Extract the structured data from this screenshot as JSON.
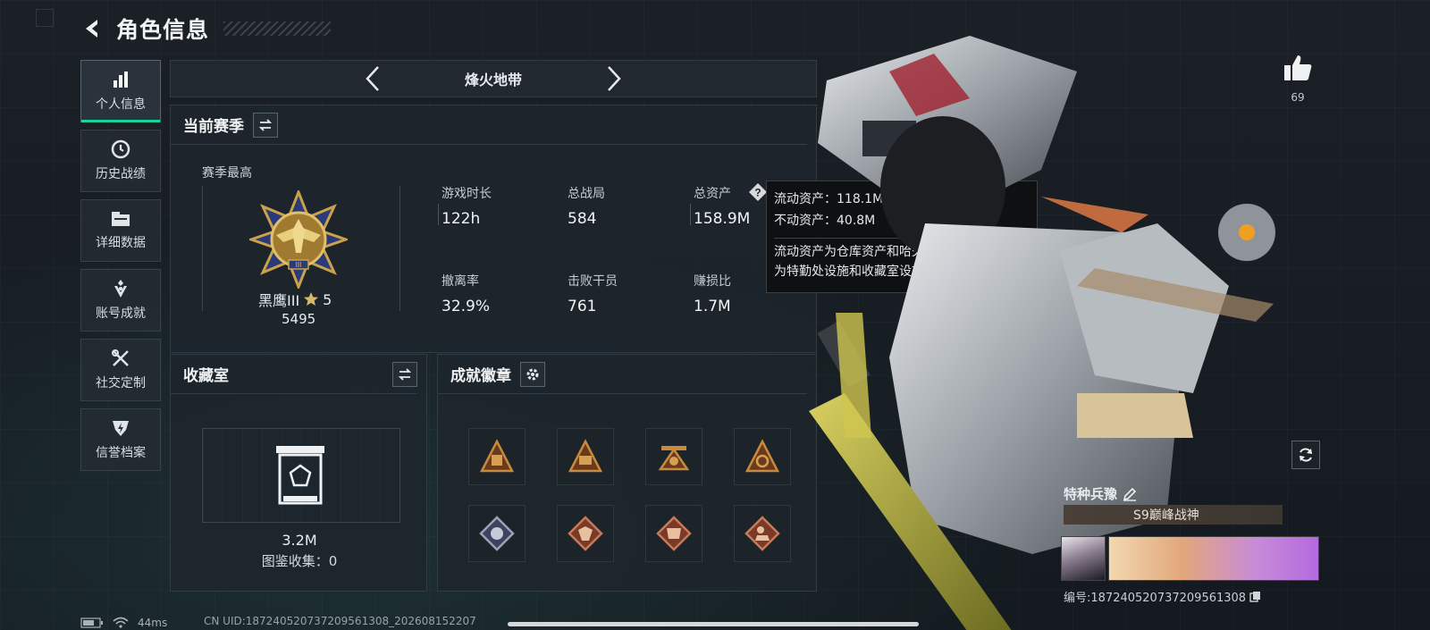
{
  "header": {
    "title": "角色信息"
  },
  "sidebar": {
    "items": [
      {
        "label": "个人信息",
        "icon": "bar-chart-icon",
        "active": true
      },
      {
        "label": "历史战绩",
        "icon": "clock-icon"
      },
      {
        "label": "详细数据",
        "icon": "folder-icon"
      },
      {
        "label": "账号成就",
        "icon": "diamond-badge-icon"
      },
      {
        "label": "社交定制",
        "icon": "tools-icon"
      },
      {
        "label": "信誉档案",
        "icon": "shield-bolt-icon"
      }
    ]
  },
  "mode": {
    "name": "烽火地带"
  },
  "season": {
    "title": "当前赛季",
    "best_label": "赛季最高",
    "rank_name": "黑鹰III",
    "rank_stars": "5",
    "rank_score": "5495",
    "stats": [
      {
        "label": "游戏时长",
        "value": "122h"
      },
      {
        "label": "总战局",
        "value": "584"
      },
      {
        "label": "总资产",
        "value": "158.9M"
      },
      {
        "label": "撤离率",
        "value": "32.9%"
      },
      {
        "label": "击败干员",
        "value": "761"
      },
      {
        "label": "赚损比",
        "value": "1.7M"
      }
    ]
  },
  "tooltip": {
    "line1": "流动资产：118.1M",
    "line2": "不动资产：40.8M",
    "line3": "流动资产为仓库资产和哈夫币，不动资产",
    "line4": "为特勤处设施和收藏室设施"
  },
  "collection": {
    "title": "收藏室",
    "value": "3.2M",
    "count_label": "图鉴收集：0"
  },
  "badges": {
    "title": "成就徽章",
    "items": [
      "badge-1",
      "badge-2",
      "badge-3",
      "badge-4",
      "badge-5",
      "badge-6",
      "badge-7",
      "badge-8"
    ]
  },
  "likes": {
    "count": "69"
  },
  "card": {
    "name": "特种兵豫",
    "title_tag": "S9巅峰战神",
    "id": "编号:18724052073720956​1308"
  },
  "status": {
    "ping": "44ms",
    "uid": "CN UID:187240520737209561308_202608152207"
  },
  "colors": {
    "accent": "#19d39a",
    "panel": "#1e252c",
    "gold": "#c9a24a"
  }
}
